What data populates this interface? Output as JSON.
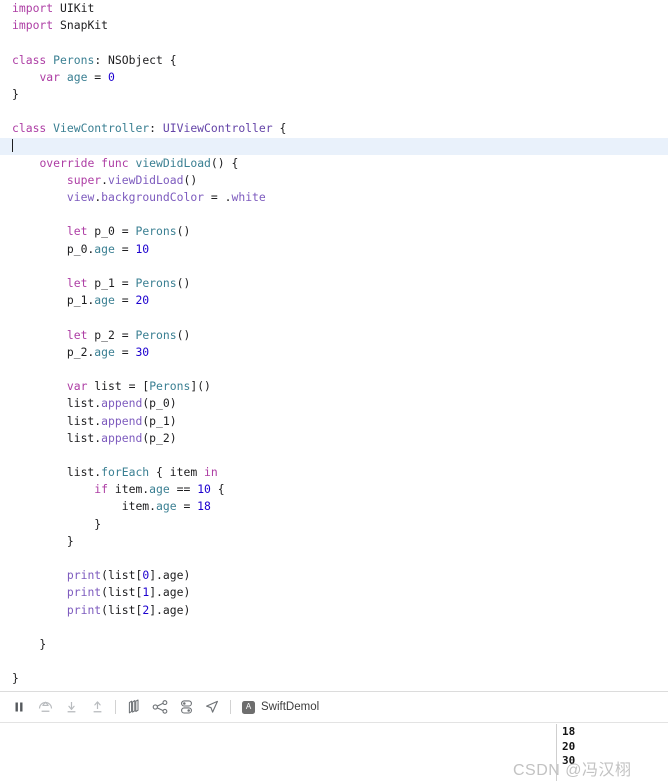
{
  "editor": {
    "language": "Swift",
    "cursor_line_index": 8,
    "lines": [
      [
        {
          "t": "import",
          "c": "kw"
        },
        {
          "t": " UIKit",
          "c": "plain"
        }
      ],
      [
        {
          "t": "import",
          "c": "kw"
        },
        {
          "t": " SnapKit",
          "c": "plain"
        }
      ],
      [],
      [
        {
          "t": "class",
          "c": "kw"
        },
        {
          "t": " ",
          "c": "plain"
        },
        {
          "t": "Perons",
          "c": "type"
        },
        {
          "t": ": NSObject {",
          "c": "plain"
        }
      ],
      [
        {
          "t": "    ",
          "c": "plain"
        },
        {
          "t": "var",
          "c": "kw"
        },
        {
          "t": " ",
          "c": "plain"
        },
        {
          "t": "age",
          "c": "prop"
        },
        {
          "t": " = ",
          "c": "plain"
        },
        {
          "t": "0",
          "c": "num"
        }
      ],
      [
        {
          "t": "}",
          "c": "plain"
        }
      ],
      [],
      [
        {
          "t": "class",
          "c": "kw"
        },
        {
          "t": " ",
          "c": "plain"
        },
        {
          "t": "ViewController",
          "c": "type"
        },
        {
          "t": ": ",
          "c": "plain"
        },
        {
          "t": "UIViewController",
          "c": "systype"
        },
        {
          "t": " {",
          "c": "plain"
        }
      ],
      [],
      [
        {
          "t": "    ",
          "c": "plain"
        },
        {
          "t": "override",
          "c": "kw"
        },
        {
          "t": " ",
          "c": "plain"
        },
        {
          "t": "func",
          "c": "kw"
        },
        {
          "t": " ",
          "c": "plain"
        },
        {
          "t": "viewDidLoad",
          "c": "type"
        },
        {
          "t": "() {",
          "c": "plain"
        }
      ],
      [
        {
          "t": "        ",
          "c": "plain"
        },
        {
          "t": "super",
          "c": "kw"
        },
        {
          "t": ".",
          "c": "plain"
        },
        {
          "t": "viewDidLoad",
          "c": "meth"
        },
        {
          "t": "()",
          "c": "plain"
        }
      ],
      [
        {
          "t": "        ",
          "c": "plain"
        },
        {
          "t": "view",
          "c": "meth"
        },
        {
          "t": ".",
          "c": "plain"
        },
        {
          "t": "backgroundColor",
          "c": "meth"
        },
        {
          "t": " = .",
          "c": "plain"
        },
        {
          "t": "white",
          "c": "meth"
        }
      ],
      [],
      [
        {
          "t": "        ",
          "c": "plain"
        },
        {
          "t": "let",
          "c": "kw"
        },
        {
          "t": " p_0 = ",
          "c": "plain"
        },
        {
          "t": "Perons",
          "c": "type"
        },
        {
          "t": "()",
          "c": "plain"
        }
      ],
      [
        {
          "t": "        p_0.",
          "c": "plain"
        },
        {
          "t": "age",
          "c": "prop"
        },
        {
          "t": " = ",
          "c": "plain"
        },
        {
          "t": "10",
          "c": "num"
        }
      ],
      [],
      [
        {
          "t": "        ",
          "c": "plain"
        },
        {
          "t": "let",
          "c": "kw"
        },
        {
          "t": " p_1 = ",
          "c": "plain"
        },
        {
          "t": "Perons",
          "c": "type"
        },
        {
          "t": "()",
          "c": "plain"
        }
      ],
      [
        {
          "t": "        p_1.",
          "c": "plain"
        },
        {
          "t": "age",
          "c": "prop"
        },
        {
          "t": " = ",
          "c": "plain"
        },
        {
          "t": "20",
          "c": "num"
        }
      ],
      [],
      [
        {
          "t": "        ",
          "c": "plain"
        },
        {
          "t": "let",
          "c": "kw"
        },
        {
          "t": " p_2 = ",
          "c": "plain"
        },
        {
          "t": "Perons",
          "c": "type"
        },
        {
          "t": "()",
          "c": "plain"
        }
      ],
      [
        {
          "t": "        p_2.",
          "c": "plain"
        },
        {
          "t": "age",
          "c": "prop"
        },
        {
          "t": " = ",
          "c": "plain"
        },
        {
          "t": "30",
          "c": "num"
        }
      ],
      [],
      [
        {
          "t": "        ",
          "c": "plain"
        },
        {
          "t": "var",
          "c": "kw"
        },
        {
          "t": " list = [",
          "c": "plain"
        },
        {
          "t": "Perons",
          "c": "type"
        },
        {
          "t": "]()",
          "c": "plain"
        }
      ],
      [
        {
          "t": "        list.",
          "c": "plain"
        },
        {
          "t": "append",
          "c": "meth"
        },
        {
          "t": "(p_0)",
          "c": "plain"
        }
      ],
      [
        {
          "t": "        list.",
          "c": "plain"
        },
        {
          "t": "append",
          "c": "meth"
        },
        {
          "t": "(p_1)",
          "c": "plain"
        }
      ],
      [
        {
          "t": "        list.",
          "c": "plain"
        },
        {
          "t": "append",
          "c": "meth"
        },
        {
          "t": "(p_2)",
          "c": "plain"
        }
      ],
      [],
      [
        {
          "t": "        list.",
          "c": "plain"
        },
        {
          "t": "forEach",
          "c": "prop"
        },
        {
          "t": " { item ",
          "c": "plain"
        },
        {
          "t": "in",
          "c": "kw"
        }
      ],
      [
        {
          "t": "            ",
          "c": "plain"
        },
        {
          "t": "if",
          "c": "kw"
        },
        {
          "t": " item.",
          "c": "plain"
        },
        {
          "t": "age",
          "c": "prop"
        },
        {
          "t": " == ",
          "c": "plain"
        },
        {
          "t": "10",
          "c": "num"
        },
        {
          "t": " {",
          "c": "plain"
        }
      ],
      [
        {
          "t": "                item.",
          "c": "plain"
        },
        {
          "t": "age",
          "c": "prop"
        },
        {
          "t": " = ",
          "c": "plain"
        },
        {
          "t": "18",
          "c": "num"
        }
      ],
      [
        {
          "t": "            }",
          "c": "plain"
        }
      ],
      [
        {
          "t": "        }",
          "c": "plain"
        }
      ],
      [],
      [
        {
          "t": "        ",
          "c": "plain"
        },
        {
          "t": "print",
          "c": "meth"
        },
        {
          "t": "(list[",
          "c": "plain"
        },
        {
          "t": "0",
          "c": "num"
        },
        {
          "t": "].age)",
          "c": "plain"
        }
      ],
      [
        {
          "t": "        ",
          "c": "plain"
        },
        {
          "t": "print",
          "c": "meth"
        },
        {
          "t": "(list[",
          "c": "plain"
        },
        {
          "t": "1",
          "c": "num"
        },
        {
          "t": "].age)",
          "c": "plain"
        }
      ],
      [
        {
          "t": "        ",
          "c": "plain"
        },
        {
          "t": "print",
          "c": "meth"
        },
        {
          "t": "(list[",
          "c": "plain"
        },
        {
          "t": "2",
          "c": "num"
        },
        {
          "t": "].age)",
          "c": "plain"
        }
      ],
      [],
      [
        {
          "t": "    }",
          "c": "plain"
        }
      ],
      [],
      [
        {
          "t": "}",
          "c": "plain"
        }
      ]
    ]
  },
  "debug_bar": {
    "buttons": [
      {
        "name": "pause-button",
        "icon": "pause-icon",
        "label": "Pause program execution"
      },
      {
        "name": "step-over-button",
        "icon": "step-over-icon",
        "label": "Step over"
      },
      {
        "name": "step-into-button",
        "icon": "step-into-icon",
        "label": "Step into"
      },
      {
        "name": "step-out-button",
        "icon": "step-out-icon",
        "label": "Step out"
      },
      {
        "name": "view-hierarchy-button",
        "icon": "view-hierarchy-icon",
        "label": "Debug View Hierarchy"
      },
      {
        "name": "memory-graph-button",
        "icon": "memory-graph-icon",
        "label": "Debug Memory Graph"
      },
      {
        "name": "environment-overrides-button",
        "icon": "environment-overrides-icon",
        "label": "Environment Overrides"
      },
      {
        "name": "simulate-location-button",
        "icon": "location-arrow-icon",
        "label": "Simulate Location"
      }
    ],
    "process": {
      "icon_glyph": "A",
      "name": "SwiftDemol"
    }
  },
  "console": {
    "output_lines": [
      "18",
      "20",
      "30"
    ]
  },
  "watermark": {
    "text": "CSDN @冯汉栩"
  },
  "colors": {
    "keyword": "#ad3da4",
    "type": "#3a7f92",
    "system_type": "#6444a8",
    "method": "#7d5bbe",
    "number": "#1c00cf",
    "plain": "#1d1d1f",
    "cursor_line_highlight": "#e9f1fb",
    "background": "#ffffff"
  }
}
